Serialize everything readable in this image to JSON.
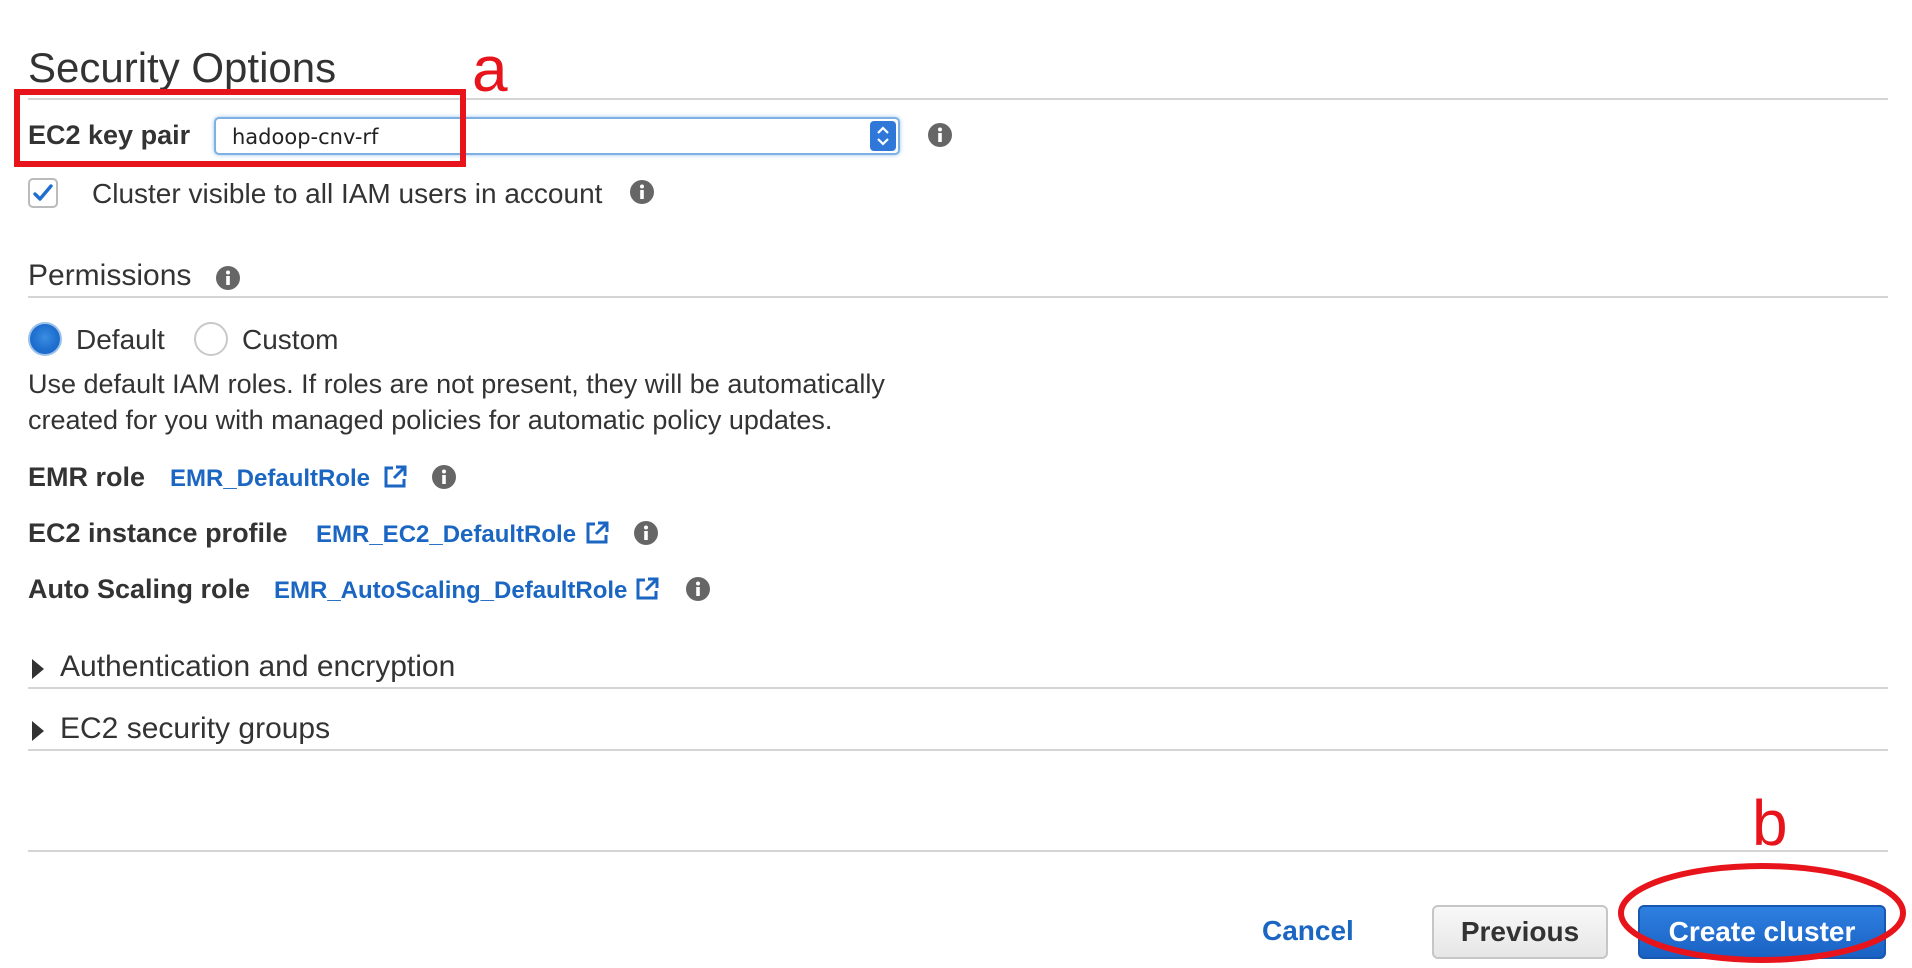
{
  "section": {
    "title": "Security Options"
  },
  "keypair": {
    "label": "EC2 key pair",
    "value": "hadoop-cnv-rf"
  },
  "visibility": {
    "label": "Cluster visible to all IAM users in account",
    "checked": true
  },
  "permissions": {
    "title": "Permissions",
    "options": [
      {
        "label": "Default",
        "selected": true
      },
      {
        "label": "Custom",
        "selected": false
      }
    ],
    "description_line1": "Use default IAM roles. If roles are not present, they will be automatically",
    "description_line2": "created for you with managed policies for automatic policy updates.",
    "roles": [
      {
        "label": "EMR role",
        "link": "EMR_DefaultRole"
      },
      {
        "label": "EC2 instance profile",
        "link": "EMR_EC2_DefaultRole"
      },
      {
        "label": "Auto Scaling role",
        "link": "EMR_AutoScaling_DefaultRole"
      }
    ]
  },
  "collapsible": [
    {
      "label": "Authentication and encryption"
    },
    {
      "label": "EC2 security groups"
    }
  ],
  "footer": {
    "cancel": "Cancel",
    "previous": "Previous",
    "create": "Create cluster"
  },
  "annotations": {
    "a": "a",
    "b": "b",
    "color": "#e8141b"
  },
  "colors": {
    "link": "#1a66c2",
    "primary_button": "#1f6fd0"
  }
}
